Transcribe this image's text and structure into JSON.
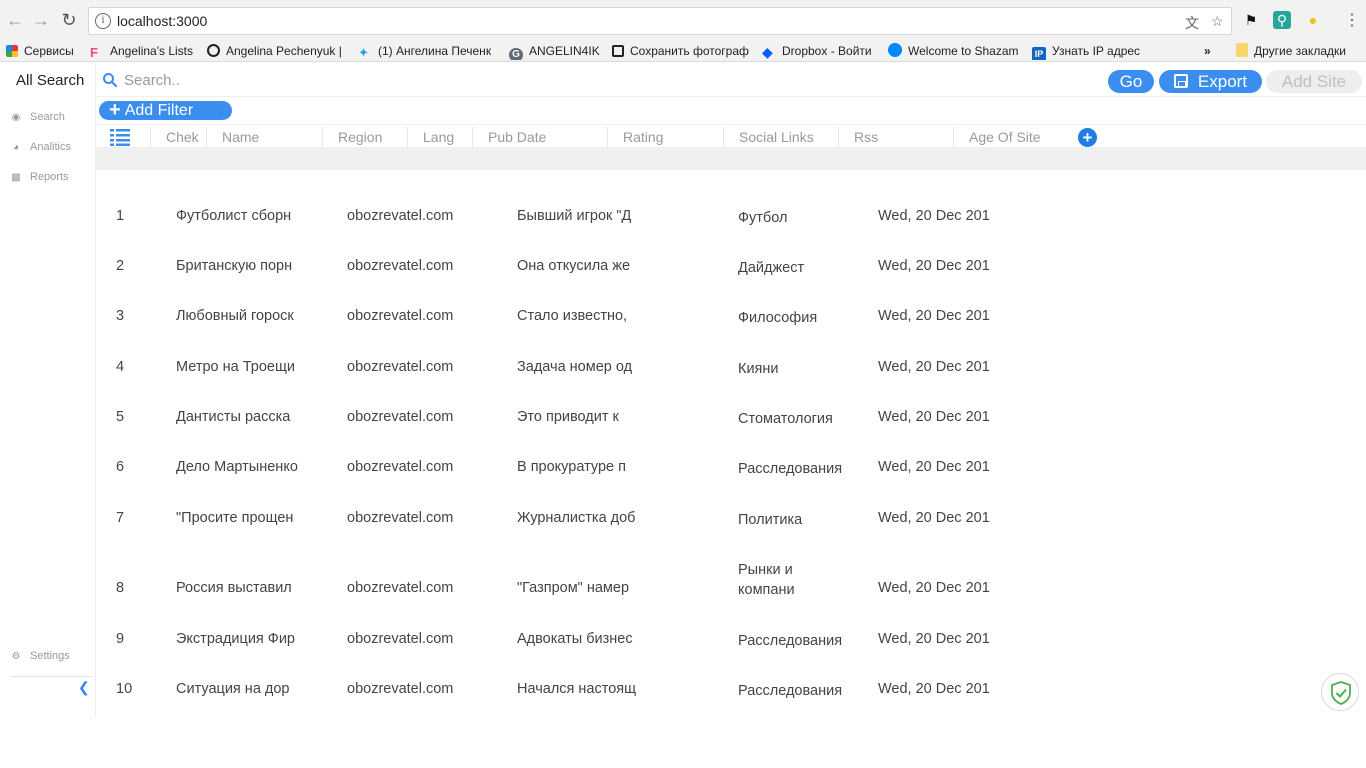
{
  "browser": {
    "url": "localhost:3000",
    "bookmarks": [
      {
        "label": "Сервисы",
        "icon": "apps-grid-icon",
        "color": "#e53935"
      },
      {
        "label": "Angelina's Lists",
        "icon": "foursquare-icon",
        "color": "#f94877"
      },
      {
        "label": "Angelina Pechenyuk |",
        "icon": "spiral-icon",
        "color": "#222222"
      },
      {
        "label": "(1) Ангелина Печенк",
        "icon": "twitter-icon",
        "color": "#1da1f2"
      },
      {
        "label": "ANGELIN4IK",
        "icon": "g-icon",
        "color": "#5f6b7a"
      },
      {
        "label": "Сохранить фотограф",
        "icon": "crop-icon",
        "color": "#222222"
      },
      {
        "label": "Dropbox - Войти",
        "icon": "dropbox-icon",
        "color": "#0061fe"
      },
      {
        "label": "Welcome to Shazam",
        "icon": "shazam-icon",
        "color": "#0088ff"
      },
      {
        "label": "Узнать IP адрес",
        "icon": "ip-icon",
        "color": "#1565c0"
      }
    ],
    "more_label": "»",
    "other_bookmarks": "Другие закладки"
  },
  "sidebar": {
    "brand": "All Search",
    "items": [
      {
        "label": "Search",
        "icon": "globe-icon"
      },
      {
        "label": "Analitics",
        "icon": "pie-chart-icon"
      },
      {
        "label": "Reports",
        "icon": "bar-chart-icon"
      }
    ],
    "settings": {
      "label": "Settings",
      "icon": "gear-icon"
    },
    "collapse_icon": "chevron-left-icon"
  },
  "topbar": {
    "search_placeholder": "Search..",
    "go_label": "Go",
    "export_label": "Export",
    "add_site_label": "Add Site"
  },
  "filter": {
    "add_label": "Add Filter"
  },
  "table": {
    "columns": [
      "Chek",
      "Name",
      "Region",
      "Lang",
      "Pub Date",
      "Rating",
      "Social Links",
      "Rss",
      "Age Of Site"
    ],
    "rows": [
      {
        "num": "1",
        "name": "Футболист сборн",
        "region": "obozrevatel.com",
        "pub": "Бывший игрок \"Д",
        "social": "Футбол",
        "date": "Wed, 20 Dec 201"
      },
      {
        "num": "2",
        "name": "Британскую порн",
        "region": "obozrevatel.com",
        "pub": "Она откусила же",
        "social": "Дайджест",
        "date": "Wed, 20 Dec 201"
      },
      {
        "num": "3",
        "name": "Любовный гороск",
        "region": "obozrevatel.com",
        "pub": "Стало известно,",
        "social": "Философия",
        "date": "Wed, 20 Dec 201"
      },
      {
        "num": "4",
        "name": "Метро на Троещи",
        "region": "obozrevatel.com",
        "pub": "Задача номер од",
        "social": "Кияни",
        "date": "Wed, 20 Dec 201"
      },
      {
        "num": "5",
        "name": "Дантисты расска",
        "region": "obozrevatel.com",
        "pub": "Это приводит к",
        "social": "Стоматология",
        "date": "Wed, 20 Dec 201"
      },
      {
        "num": "6",
        "name": "Дело Мартыненко",
        "region": "obozrevatel.com",
        "pub": "В прокуратуре п",
        "social": "Расследования",
        "date": "Wed, 20 Dec 201"
      },
      {
        "num": "7",
        "name": "\"Просите прощен",
        "region": "obozrevatel.com",
        "pub": "Журналистка доб",
        "social": "Политика",
        "date": "Wed, 20 Dec 201"
      },
      {
        "num": "8",
        "name": "Россия выставил",
        "region": "obozrevatel.com",
        "pub": "\"Газпром\" намер",
        "social": "Рынки и компани",
        "date": "Wed, 20 Dec 201"
      },
      {
        "num": "9",
        "name": "Экстрадиция Фир",
        "region": "obozrevatel.com",
        "pub": "Адвокаты бизнес",
        "social": "Расследования",
        "date": "Wed, 20 Dec 201"
      },
      {
        "num": "10",
        "name": "Ситуация на дор",
        "region": "obozrevatel.com",
        "pub": "Начался настоящ",
        "social": "Расследования",
        "date": "Wed, 20 Dec 201"
      }
    ]
  },
  "colors": {
    "accent": "#3b8def",
    "add_column": "#1e7fe3",
    "shield": "#4caf50"
  }
}
